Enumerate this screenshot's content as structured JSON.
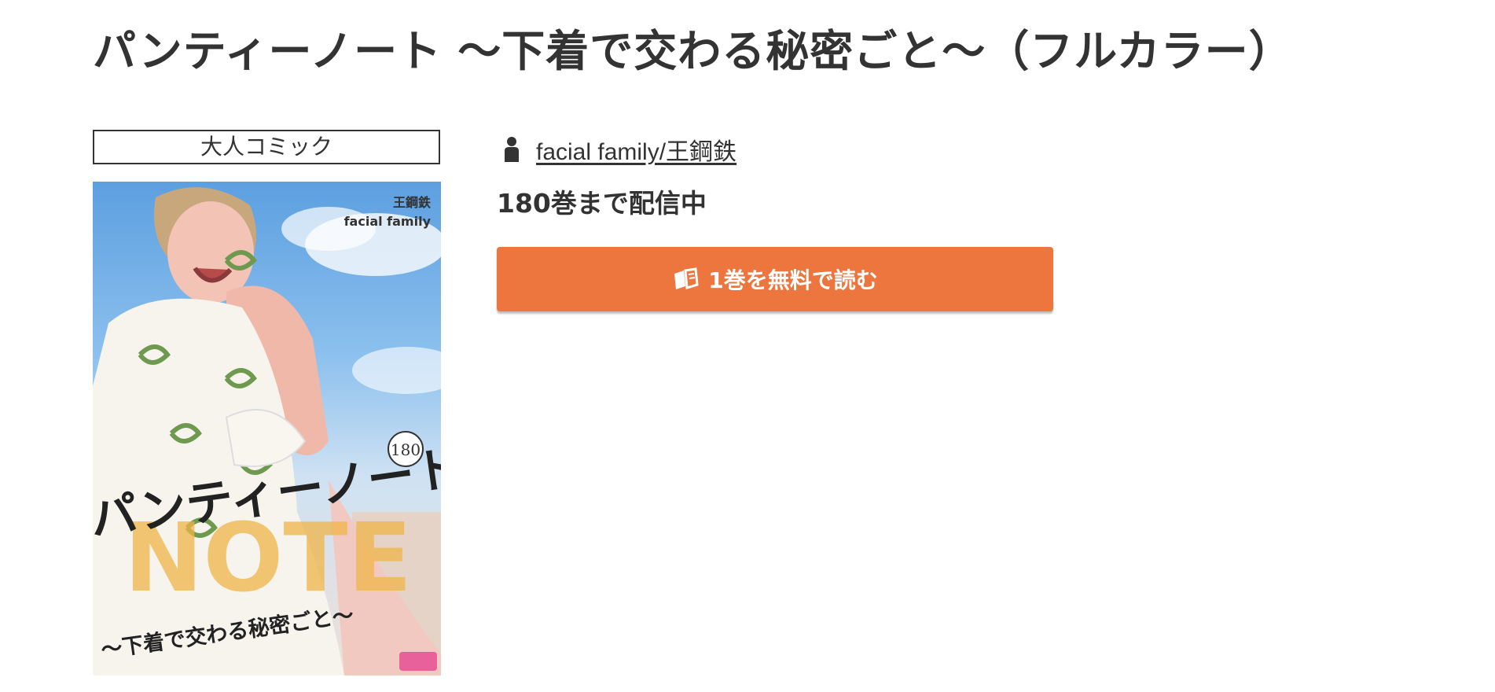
{
  "page": {
    "title": "パンティーノート ～下着で交わる秘密ごと～（フルカラー）"
  },
  "genre": {
    "label": "大人コミック"
  },
  "author": {
    "icon": "person-icon",
    "link_text": "facial family/王鋼鉄"
  },
  "status": {
    "volumes_text": "180巻まで配信中"
  },
  "read_button": {
    "icon": "open-book-icon",
    "label": "1巻を無料で読む",
    "color": "#ed763e"
  },
  "cover": {
    "credit_original": "王鋼鉄",
    "credit_art": "facial family",
    "volume_number": "180",
    "title_text": "パンティーノート",
    "subtitle_text": "～下着で交わる秘密ごと～",
    "logo_text": "NOTE"
  },
  "colors": {
    "text": "#333333",
    "button": "#ed763e",
    "background": "#ffffff"
  }
}
